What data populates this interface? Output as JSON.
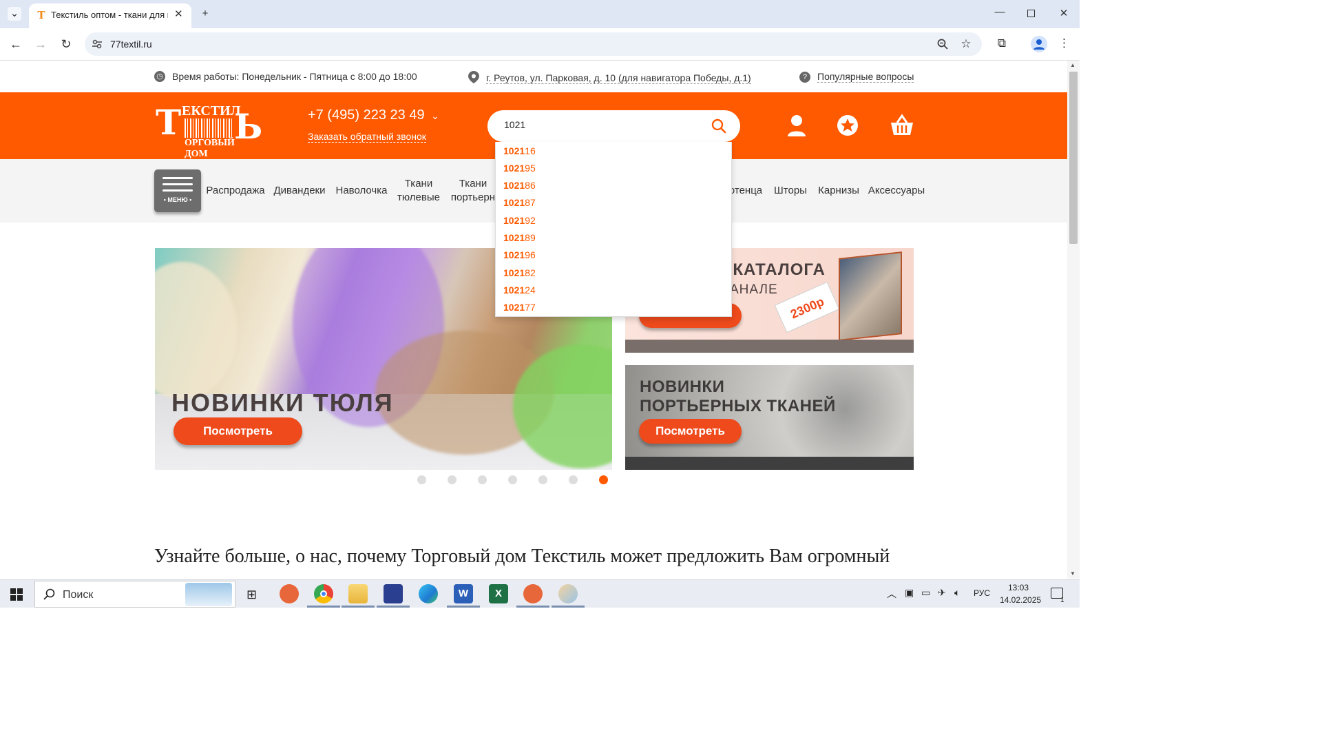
{
  "browser": {
    "tab_title": "Текстиль оптом - ткани для шт",
    "url": "77textil.ru"
  },
  "info": {
    "hours": "Время работы: Понедельник - Пятница с 8:00 до 18:00",
    "address": "г. Реутов, ул. Парковая, д. 10 (для навигатора Победы, д.1)",
    "faq": "Популярные вопросы"
  },
  "header": {
    "logo_big": "Т",
    "logo_top": "ЕКСТИЛ",
    "logo_end": "Ь",
    "logo_bottom": "ОРГОВЫЙ ДОМ",
    "phone": "+7 (495) 223 23 49",
    "callback": "Заказать обратный звонок",
    "search_value": "1021"
  },
  "nav": {
    "menu_label": "• МЕНЮ •",
    "items": [
      "Распродажа",
      "Дивандеки",
      "Наволочка",
      "Ткани тюлевые",
      "Ткани портьерн",
      "отенца",
      "Шторы",
      "Карнизы",
      "Аксессуары"
    ]
  },
  "suggestions": {
    "prefix": "1021",
    "suffixes": [
      "16",
      "95",
      "86",
      "87",
      "92",
      "89",
      "96",
      "82",
      "24",
      "77"
    ]
  },
  "banners": {
    "main_title": "НОВИНКИ ТЮЛЯ",
    "main_button": "Посмотреть",
    "catalog_line1": "ОР КАТАЛОГА",
    "catalog_line2": "АНАЛЕ",
    "catalog_price": "2300р",
    "new_line1": "НОВИНКИ",
    "new_line2": "ПОРТЬЕРНЫХ ТКАНЕЙ",
    "new_button": "Посмотреть"
  },
  "slider": {
    "count": 7,
    "active": 6
  },
  "headline": "Узнайте больше, о нас, почему Торговый дом Текстиль может предложить Вам огромный",
  "taskbar": {
    "search": "Поиск",
    "lang": "РУС",
    "time": "13:03",
    "date": "14.02.2025",
    "notifications": "1"
  },
  "colors": {
    "brand": "#ff5a00",
    "nav_bg": "#f4f4f4"
  }
}
